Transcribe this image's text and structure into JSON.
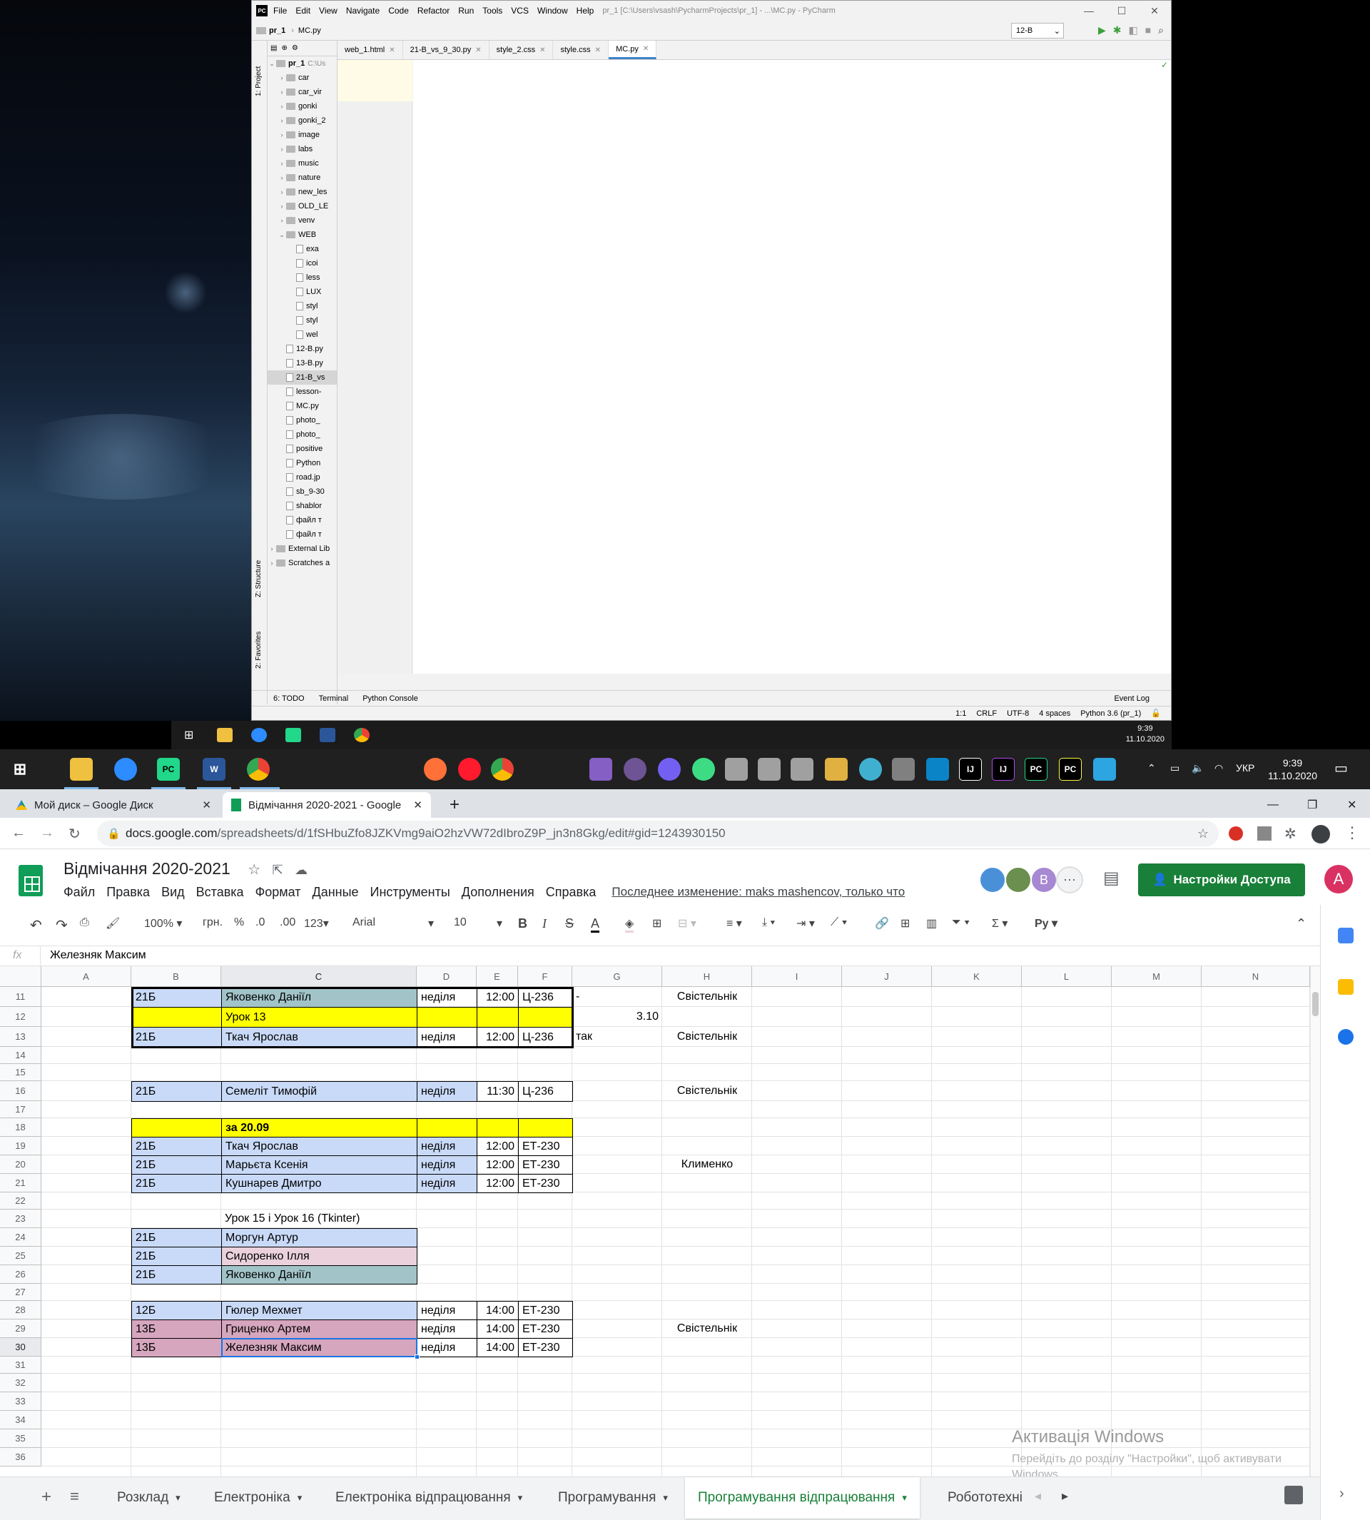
{
  "remote": {
    "pycharm": {
      "window_title": "pr_1 [C:\\Users\\vsash\\PycharmProjects\\pr_1] - ...\\MC.py - PyCharm",
      "logo": "PC",
      "menu": [
        "File",
        "Edit",
        "View",
        "Navigate",
        "Code",
        "Refactor",
        "Run",
        "Tools",
        "VCS",
        "Window",
        "Help"
      ],
      "breadcrumb": [
        "pr_1",
        "MC.py"
      ],
      "run_config": "12-B",
      "side_tabs": [
        "1: Project",
        "Z: Structure",
        "2: Favorites"
      ],
      "tree_root": "pr_1",
      "tree_root_path": "C:\\Us",
      "tree": [
        {
          "label": "car",
          "kind": "folder",
          "indent": 1
        },
        {
          "label": "car_vir",
          "kind": "folder",
          "indent": 1
        },
        {
          "label": "gonki",
          "kind": "folder",
          "indent": 1
        },
        {
          "label": "gonki_2",
          "kind": "folder",
          "indent": 1
        },
        {
          "label": "image",
          "kind": "folder",
          "indent": 1
        },
        {
          "label": "labs",
          "kind": "folder",
          "indent": 1
        },
        {
          "label": "music",
          "kind": "folder",
          "indent": 1
        },
        {
          "label": "nature",
          "kind": "folder",
          "indent": 1
        },
        {
          "label": "new_les",
          "kind": "folder",
          "indent": 1
        },
        {
          "label": "OLD_LE",
          "kind": "folder",
          "indent": 1
        },
        {
          "label": "venv",
          "kind": "folder",
          "indent": 1
        },
        {
          "label": "WEB",
          "kind": "folder",
          "indent": 1
        },
        {
          "label": "exa",
          "kind": "file",
          "indent": 2
        },
        {
          "label": "icoi",
          "kind": "file",
          "indent": 2
        },
        {
          "label": "less",
          "kind": "file",
          "indent": 2
        },
        {
          "label": "LUX",
          "kind": "file",
          "indent": 2
        },
        {
          "label": "styl",
          "kind": "file",
          "indent": 2
        },
        {
          "label": "styl",
          "kind": "file",
          "indent": 2
        },
        {
          "label": "wel",
          "kind": "file",
          "indent": 2
        },
        {
          "label": "12-B.py",
          "kind": "file",
          "indent": 1
        },
        {
          "label": "13-B.py",
          "kind": "file",
          "indent": 1
        },
        {
          "label": "21-B_vs",
          "kind": "file",
          "indent": 1
        },
        {
          "label": "lesson-",
          "kind": "file",
          "indent": 1
        },
        {
          "label": "MC.py",
          "kind": "file",
          "indent": 1
        },
        {
          "label": "photo_",
          "kind": "file",
          "indent": 1
        },
        {
          "label": "photo_",
          "kind": "file",
          "indent": 1
        },
        {
          "label": "positive",
          "kind": "file",
          "indent": 1
        },
        {
          "label": "Python",
          "kind": "file",
          "indent": 1
        },
        {
          "label": "road.jp",
          "kind": "file",
          "indent": 1
        },
        {
          "label": "sb_9-30",
          "kind": "file",
          "indent": 1
        },
        {
          "label": "shablor",
          "kind": "file",
          "indent": 1
        },
        {
          "label": "файл т",
          "kind": "file",
          "indent": 1
        },
        {
          "label": "файл т",
          "kind": "file",
          "indent": 1
        },
        {
          "label": "External Lib",
          "kind": "lib",
          "indent": 0
        },
        {
          "label": "Scratches a",
          "kind": "lib",
          "indent": 0
        }
      ],
      "editor_tabs": [
        "web_1.html",
        "21-B_vs_9_30.py",
        "style_2.css",
        "style.css",
        "MC.py"
      ],
      "bottom_tabs": [
        "6: TODO",
        "Terminal",
        "Python Console"
      ],
      "event_log": "Event Log",
      "status": [
        "1:1",
        "CRLF",
        "UTF-8",
        "4 spaces",
        "Python 3.6 (pr_1)"
      ]
    },
    "taskbar_time": "9:39",
    "taskbar_date": "11.10.2020"
  },
  "host_taskbar": {
    "lang": "УКР",
    "time": "9:39",
    "date": "11.10.2020"
  },
  "chrome": {
    "tabs": [
      {
        "title": "Мой диск – Google Диск",
        "active": false
      },
      {
        "title": "Відмічання 2020-2021 - Google",
        "active": true
      }
    ],
    "url_host": "docs.google.com",
    "url_path": "/spreadsheets/d/1fSHbuZfo8JZKVmg9aiO2hzVW72dIbroZ9P_jn3n8Gkg/edit#gid=1243930150"
  },
  "sheets": {
    "title": "Відмічання 2020-2021",
    "menu": [
      "Файл",
      "Правка",
      "Вид",
      "Вставка",
      "Формат",
      "Данные",
      "Инструменты",
      "Дополнения",
      "Справка"
    ],
    "last_edit": "Последнее изменение: maks mashencov, только что",
    "share_label": "Настройки Доступа",
    "avatar_letter": "A",
    "collab_letter": "B",
    "toolbar": {
      "zoom": "100%",
      "currency": "грн.",
      "percent": "%",
      "dec_less": ".0",
      "dec_more": ".00",
      "format": "123",
      "font": "Arial",
      "size": "10"
    },
    "fx": "fx",
    "formula_value": "Железняк Максим",
    "columns": [
      "A",
      "B",
      "C",
      "D",
      "E",
      "F",
      "G",
      "H",
      "I",
      "J",
      "K",
      "L",
      "M",
      "N"
    ],
    "rows": [
      "11",
      "12",
      "13",
      "14",
      "15",
      "16",
      "17",
      "18",
      "19",
      "20",
      "21",
      "22",
      "23",
      "24",
      "25",
      "26",
      "27",
      "28",
      "29",
      "30",
      "31",
      "32",
      "33",
      "34",
      "35",
      "36"
    ],
    "cells": {
      "r11": {
        "b": "21Б",
        "c": "Яковенко Даніїл",
        "d": "неділя",
        "e": "12:00",
        "f": "Ц-236",
        "g": "-",
        "h": "Свістельнік"
      },
      "r12": {
        "c": "Урок 13",
        "g": "3.10"
      },
      "r13": {
        "b": "21Б",
        "c": "Ткач Ярослав",
        "d": "неділя",
        "e": "12:00",
        "f": "Ц-236",
        "g": "так",
        "h": "Свістельнік"
      },
      "r16": {
        "b": "21Б",
        "c": "Семеліт Тимофій",
        "d": "неділя",
        "e": "11:30",
        "f": "Ц-236",
        "h": "Свістельнік"
      },
      "r18": {
        "c": "за 20.09"
      },
      "r19": {
        "b": "21Б",
        "c": "Ткач Ярослав",
        "d": "неділя",
        "e": "12:00",
        "f": "ЕТ-230"
      },
      "r20": {
        "b": "21Б",
        "c": "Марьєта Ксенія",
        "d": "неділя",
        "e": "12:00",
        "f": "ЕТ-230",
        "h": "Клименко"
      },
      "r21": {
        "b": "21Б",
        "c": "Кушнарев Дмитро",
        "d": "неділя",
        "e": "12:00",
        "f": "ЕТ-230"
      },
      "r23": {
        "c": "Урок 15  і Урок 16 (Tkinter)"
      },
      "r24": {
        "b": "21Б",
        "c": "Моргун Артур"
      },
      "r25": {
        "b": "21Б",
        "c": "Сидоренко Ілля"
      },
      "r26": {
        "b": "21Б",
        "c": "Яковенко Даніїл"
      },
      "r28": {
        "b": "12Б",
        "c": "Гюлер Мехмет",
        "d": "неділя",
        "e": "14:00",
        "f": "ЕТ-230"
      },
      "r29": {
        "b": "13Б",
        "c": "Гриценко Артем",
        "d": "неділя",
        "e": "14:00",
        "f": "ЕТ-230",
        "h": "Свістельнік"
      },
      "r30": {
        "b": "13Б",
        "c": "Железняк Максим",
        "d": "неділя",
        "e": "14:00",
        "f": "ЕТ-230"
      }
    },
    "sheet_tabs": [
      "Розклад",
      "Електроніка",
      "Електроніка відпрацювання",
      "Програмування",
      "Програмування відпрацювання",
      "Робототехні"
    ],
    "active_sheet": "Програмування відпрацювання"
  },
  "watermark": {
    "title": "Активація Windows",
    "line1": "Перейдіть до розділу \"Настройки\", щоб активувати",
    "line2": "Windows."
  },
  "colors": {
    "sheets_green": "#188038",
    "yellow": "#ffff00",
    "blue": "#c9daf8",
    "teal": "#a2c4c9",
    "pink": "#ead1dc",
    "mauve": "#d5a6bd"
  }
}
